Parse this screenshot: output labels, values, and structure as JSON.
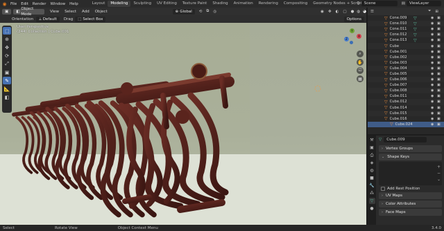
{
  "topbar": {
    "menus": [
      "File",
      "Edit",
      "Render",
      "Window",
      "Help"
    ],
    "workspaces": [
      "Layout",
      "Modeling",
      "Sculpting",
      "UV Editing",
      "Texture Paint",
      "Shading",
      "Animation",
      "Rendering",
      "Compositing",
      "Geometry Nodes",
      "Scripting"
    ],
    "active_workspace": "Modeling",
    "scene": "Scene",
    "view_layer": "ViewLayer"
  },
  "viewport_header": {
    "mode": "Object Mode",
    "menus": [
      "View",
      "Select",
      "Add",
      "Object"
    ],
    "transform": "Global"
  },
  "viewport_sub": {
    "orientation_label": "Orientation",
    "orientation_value": "Default",
    "drag_label": "Drag",
    "drag_value": "Select Box",
    "options": "Options"
  },
  "viewport": {
    "line1": "User Perspective",
    "line2": "(244) Collection | Cube.001"
  },
  "outliner": {
    "rows": [
      {
        "name": "Cone.009"
      },
      {
        "name": "Cone.010"
      },
      {
        "name": "Cone.011"
      },
      {
        "name": "Cone.012"
      },
      {
        "name": "Cone.013"
      },
      {
        "name": "Cube"
      },
      {
        "name": "Cube.001"
      },
      {
        "name": "Cube.002"
      },
      {
        "name": "Cube.003"
      },
      {
        "name": "Cube.004"
      },
      {
        "name": "Cube.005"
      },
      {
        "name": "Cube.006"
      },
      {
        "name": "Cube.007"
      },
      {
        "name": "Cube.008"
      },
      {
        "name": "Cube.011"
      },
      {
        "name": "Cube.012"
      },
      {
        "name": "Cube.014"
      },
      {
        "name": "Cube.015"
      },
      {
        "name": "Cube.016"
      },
      {
        "name": "Cube.024"
      }
    ]
  },
  "properties": {
    "object_name": "Cube.009",
    "panels": {
      "vertex_groups": "Vertex Groups",
      "shape_keys": "Shape Keys",
      "add_rest_position": "Add Rest Position",
      "uv_maps": "UV Maps",
      "color_attributes": "Color Attributes",
      "face_maps": "Face Maps"
    }
  },
  "status": {
    "select": "Select",
    "rotate": "Rotate View",
    "context": "Object Context Menu",
    "version": "3.4.0"
  },
  "colors": {
    "accent": "#4772b3",
    "selection": "#e98a3a",
    "wood": "#4a1f1a",
    "modifier": "#5bbfa0"
  }
}
